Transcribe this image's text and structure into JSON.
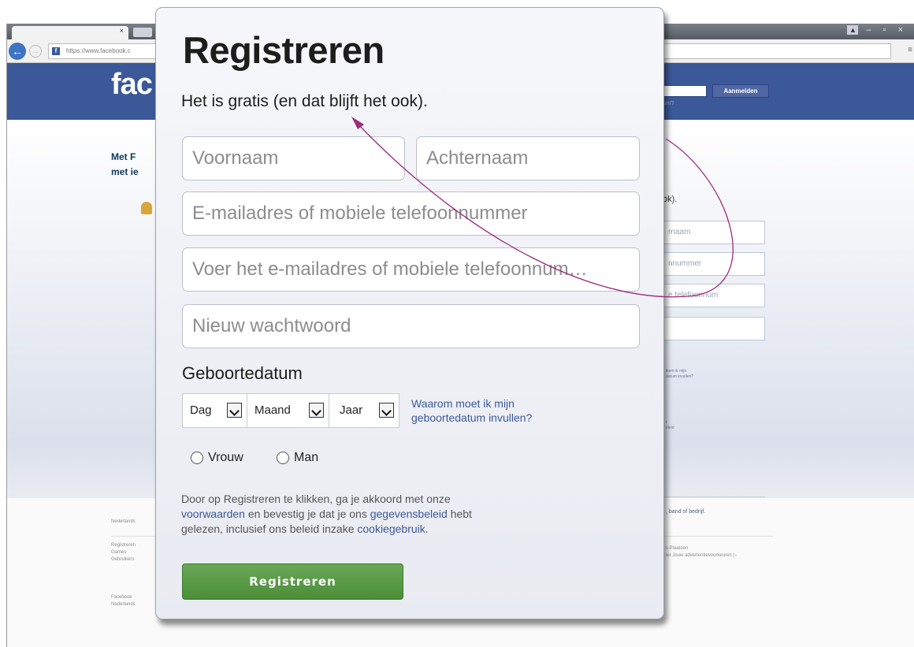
{
  "browser": {
    "url": "https://www.facebook.c",
    "tab_close": "×",
    "back_glyph": "←",
    "forward_glyph": "→",
    "menu_glyph": "≡",
    "window_controls": "– ▫ ×",
    "user_glyph": "▲"
  },
  "facebook_page": {
    "logo": "fac",
    "login_button": "Aanmelden",
    "forgot": "account?",
    "tagline_line1": "Met F",
    "tagline_line2": "met ie",
    "right_heading": "ok).",
    "ghost_fields": [
      "rnaam",
      "nnummer",
      "e telefoonnum",
      ""
    ],
    "ghost_note_1a": "ikom ik mijn",
    "ghost_note_1b": "datum invullen?",
    "ghost_note_2a": "r",
    "ghost_note_2b": "eleid",
    "page_link": ", band of bedrijf.",
    "footer_lang": "Nederlands",
    "footer_col1": [
      "Registreren",
      "Games",
      "Gebruikers"
    ],
    "footer_col2": [
      "Facebook",
      "Nederlands"
    ],
    "footer_right1": "s   Plaatsen",
    "footer_right2": "ier   Jouw advertentievoorkeuren ▷"
  },
  "dialog": {
    "title": "Registreren",
    "subtitle": "Het is gratis (en dat blijft het ook).",
    "firstname_placeholder": "Voornaam",
    "lastname_placeholder": "Achternaam",
    "email_placeholder": "E-mailadres of mobiele telefoonnummer",
    "email_confirm_placeholder": "Voer het e-mailadres of mobiele telefoonnum…",
    "password_placeholder": "Nieuw wachtwoord",
    "birthday_label": "Geboortedatum",
    "day": "Dag",
    "month": "Maand",
    "year": "Jaar",
    "why_line1": "Waarom moet ik mijn",
    "why_line2": "geboortedatum invullen?",
    "gender_female": "Vrouw",
    "gender_male": "Man",
    "terms_1": "Door op Registreren te klikken, ga je akkoord met onze",
    "terms_link_voorwaarden": "voorwaarden",
    "terms_2": " en bevestig je dat je ons ",
    "terms_link_gegevensbeleid": "gegevensbeleid",
    "terms_3": " hebt",
    "terms_4": "gelezen, inclusief ons beleid inzake ",
    "terms_link_cookies": "cookiegebruik",
    "terms_5": ".",
    "register_button": "Registreren"
  },
  "colors": {
    "facebook_blue": "#3b5998",
    "link_blue": "#3b5998",
    "button_green": "#5a9e46",
    "arrow": "#9c2b7d"
  },
  "annotation": {
    "type": "curved-arrow",
    "color": "#9c2b7d"
  }
}
